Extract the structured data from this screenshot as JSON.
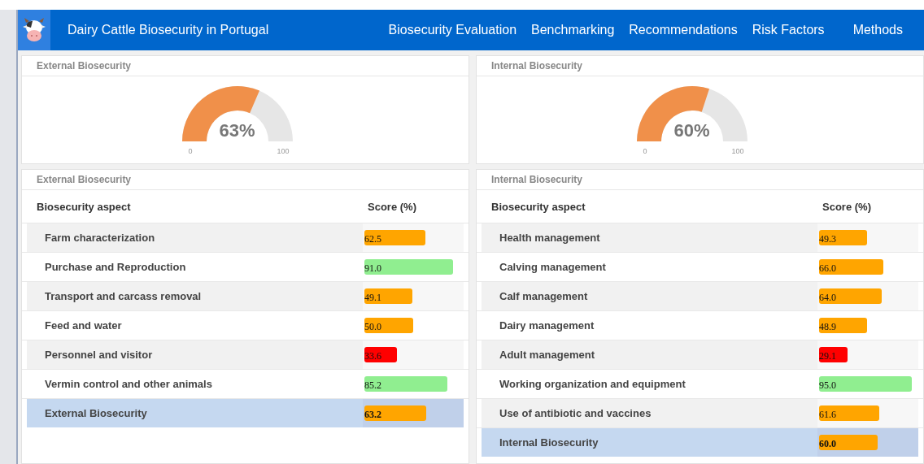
{
  "header": {
    "title": "Dairy Cattle Biosecurity in Portugal",
    "nav": [
      {
        "label": "Biosecurity Evaluation"
      },
      {
        "label": "Benchmarking"
      },
      {
        "label": "Recommendations"
      },
      {
        "label": "Risk Factors"
      },
      {
        "label": "Methods"
      }
    ]
  },
  "panels": [
    {
      "gauge": {
        "title": "External Biosecurity",
        "value": "63%",
        "min": "0",
        "max": "100"
      },
      "table": {
        "title": "External Biosecurity",
        "columns": [
          "Biosecurity aspect",
          "Score (%)"
        ],
        "rows": [
          {
            "kind": "item",
            "aspect": "Farm characterization",
            "score": "62.5",
            "color": "#ffa500"
          },
          {
            "kind": "item",
            "aspect": "Purchase and Reproduction",
            "score": "91.0",
            "color": "#90ee90"
          },
          {
            "kind": "item",
            "aspect": "Transport and carcass removal",
            "score": "49.1",
            "color": "#ffa500"
          },
          {
            "kind": "item",
            "aspect": "Feed and water",
            "score": "50.0",
            "color": "#ffa500"
          },
          {
            "kind": "item",
            "aspect": "Personnel and visitor",
            "score": "33.6",
            "color": "#ff0000"
          },
          {
            "kind": "item",
            "aspect": "Vermin control and other animals",
            "score": "85.2",
            "color": "#90ee90"
          },
          {
            "kind": "total",
            "aspect": "External Biosecurity",
            "score": "63.2",
            "color": "#ffa500"
          }
        ]
      }
    },
    {
      "gauge": {
        "title": "Internal Biosecurity",
        "value": "60%",
        "min": "0",
        "max": "100"
      },
      "table": {
        "title": "Internal Biosecurity",
        "columns": [
          "Biosecurity  aspect",
          "Score (%)"
        ],
        "rows": [
          {
            "kind": "item",
            "aspect": "Health management",
            "score": "49.3",
            "color": "#ffa500"
          },
          {
            "kind": "item",
            "aspect": "Calving management",
            "score": "66.0",
            "color": "#ffa500"
          },
          {
            "kind": "item",
            "aspect": "Calf management",
            "score": "64.0",
            "color": "#ffa500"
          },
          {
            "kind": "item",
            "aspect": "Dairy management",
            "score": "48.9",
            "color": "#ffa500"
          },
          {
            "kind": "item",
            "aspect": "Adult management",
            "score": "29.1",
            "color": "#ff0000"
          },
          {
            "kind": "item",
            "aspect": "Working organization and equipment",
            "score": "95.0",
            "color": "#90ee90"
          },
          {
            "kind": "item",
            "aspect": "Use of antibiotic and vaccines",
            "score": "61.6",
            "color": "#ffa500"
          },
          {
            "kind": "total",
            "aspect": "Internal Biosecurity",
            "score": "60.0",
            "color": "#ffa500"
          }
        ]
      }
    }
  ]
}
